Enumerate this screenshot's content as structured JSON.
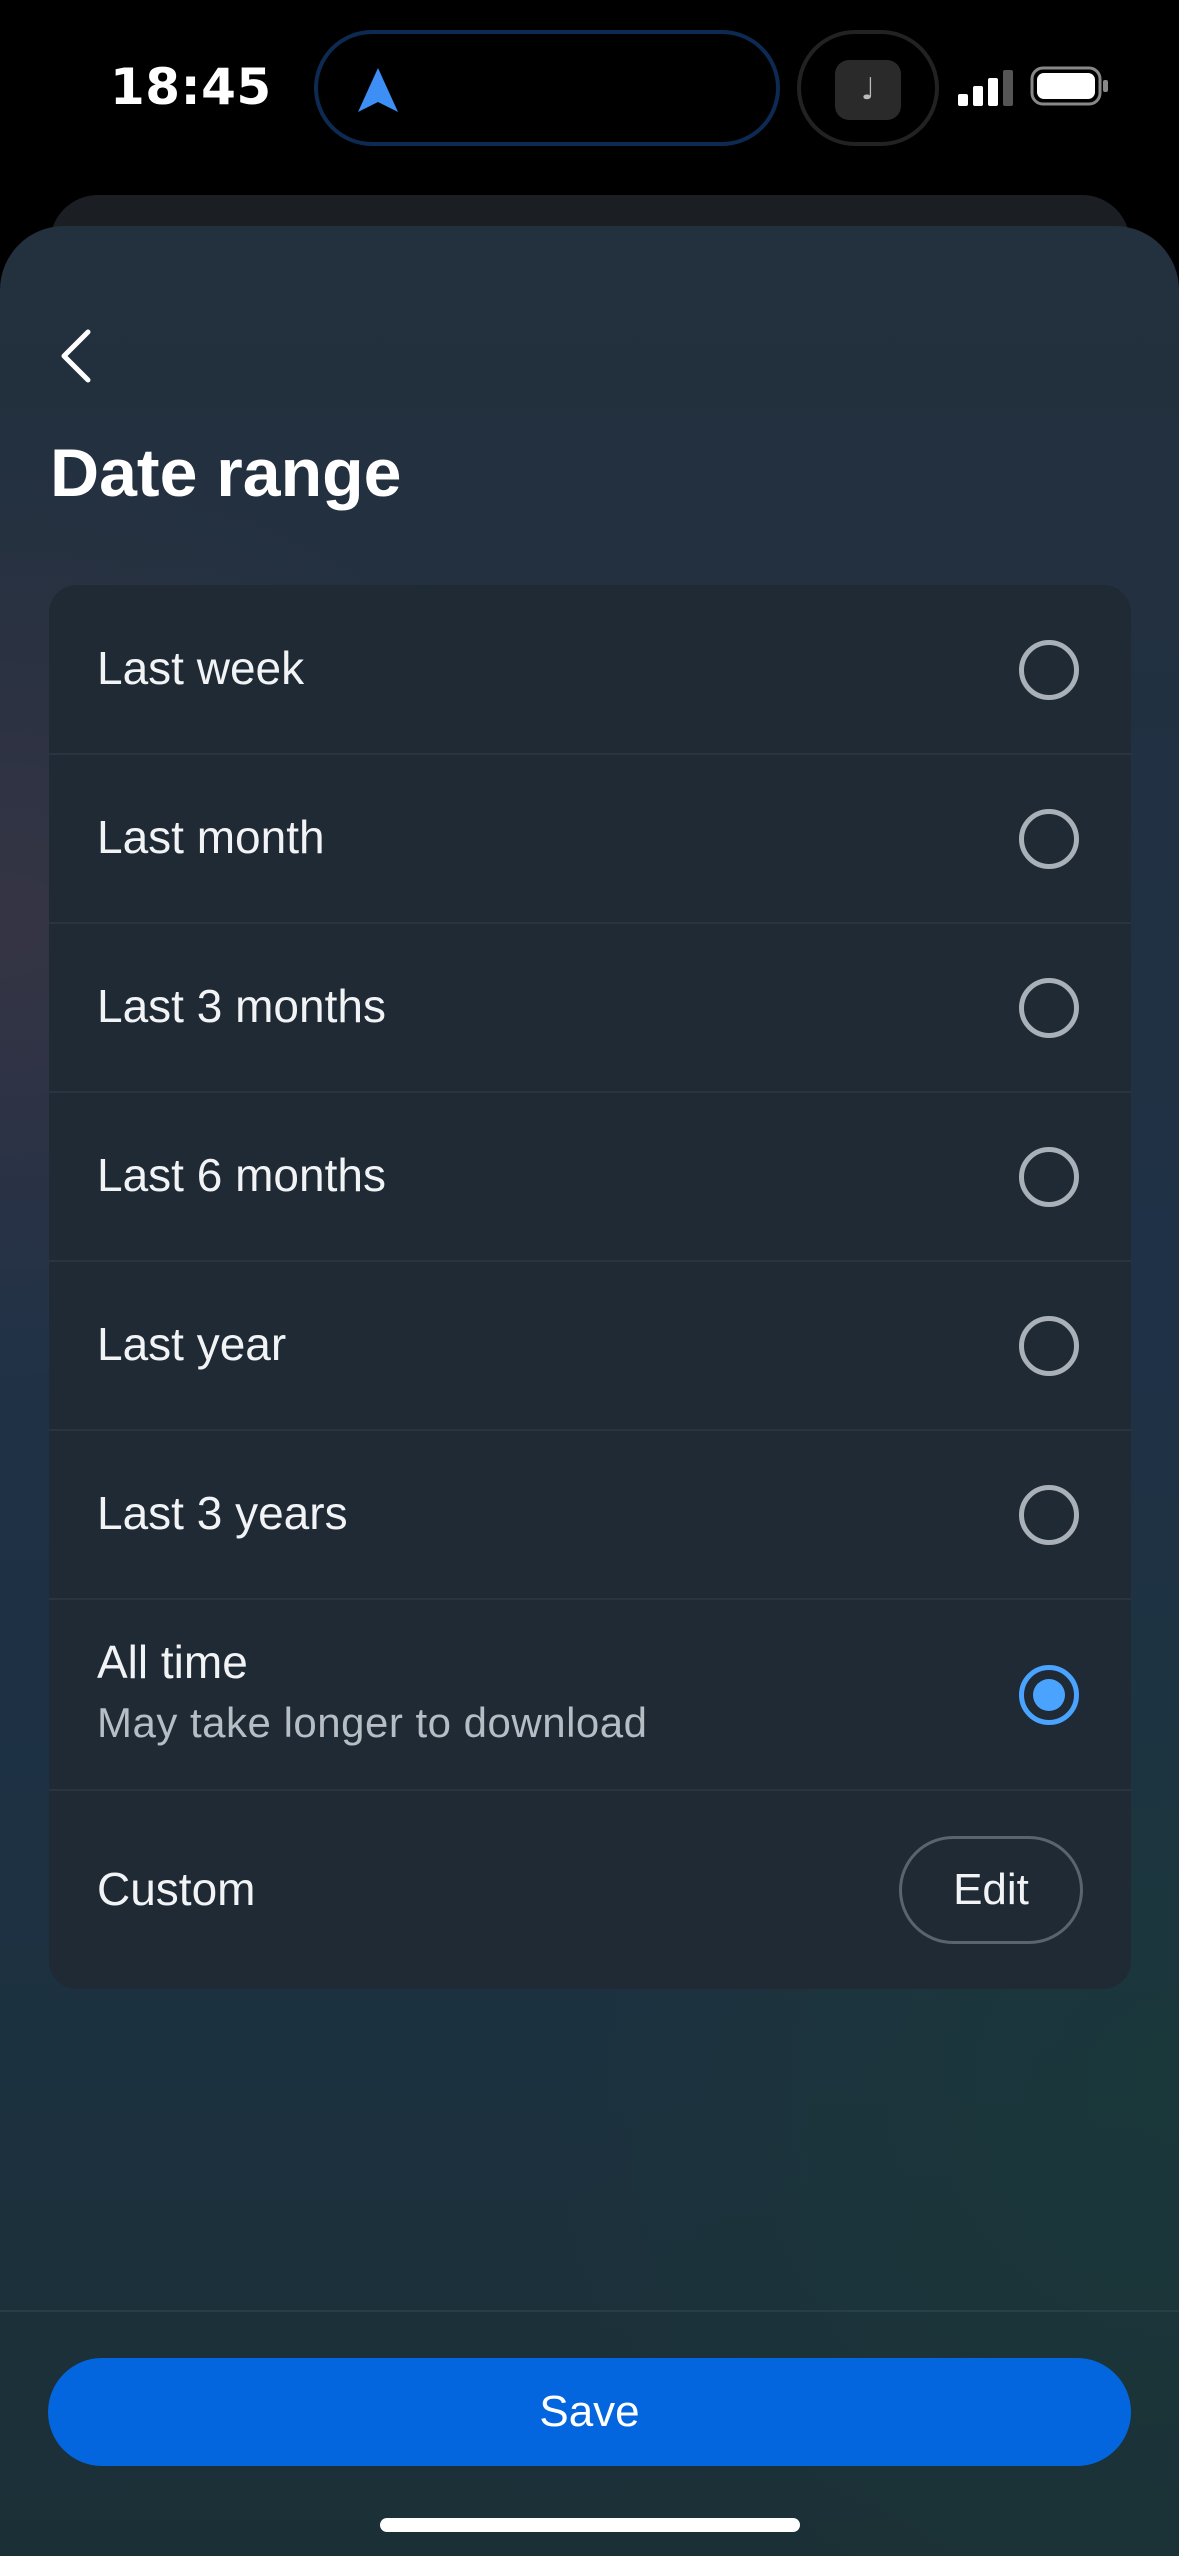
{
  "status_bar": {
    "time": "18:45"
  },
  "island_music_glyph": "♩",
  "header": {
    "title": "Date range"
  },
  "options": [
    {
      "label": "Last week",
      "selected": false
    },
    {
      "label": "Last month",
      "selected": false
    },
    {
      "label": "Last 3 months",
      "selected": false
    },
    {
      "label": "Last 6 months",
      "selected": false
    },
    {
      "label": "Last year",
      "selected": false
    },
    {
      "label": "Last 3 years",
      "selected": false
    },
    {
      "label": "All time",
      "subtitle": "May take longer to download",
      "selected": true
    }
  ],
  "custom": {
    "label": "Custom",
    "edit_label": "Edit"
  },
  "footer": {
    "save_label": "Save"
  },
  "colors": {
    "accent": "#0466de",
    "radio_selected": "#4aa3ff",
    "card_bg": "#1f2a35"
  }
}
